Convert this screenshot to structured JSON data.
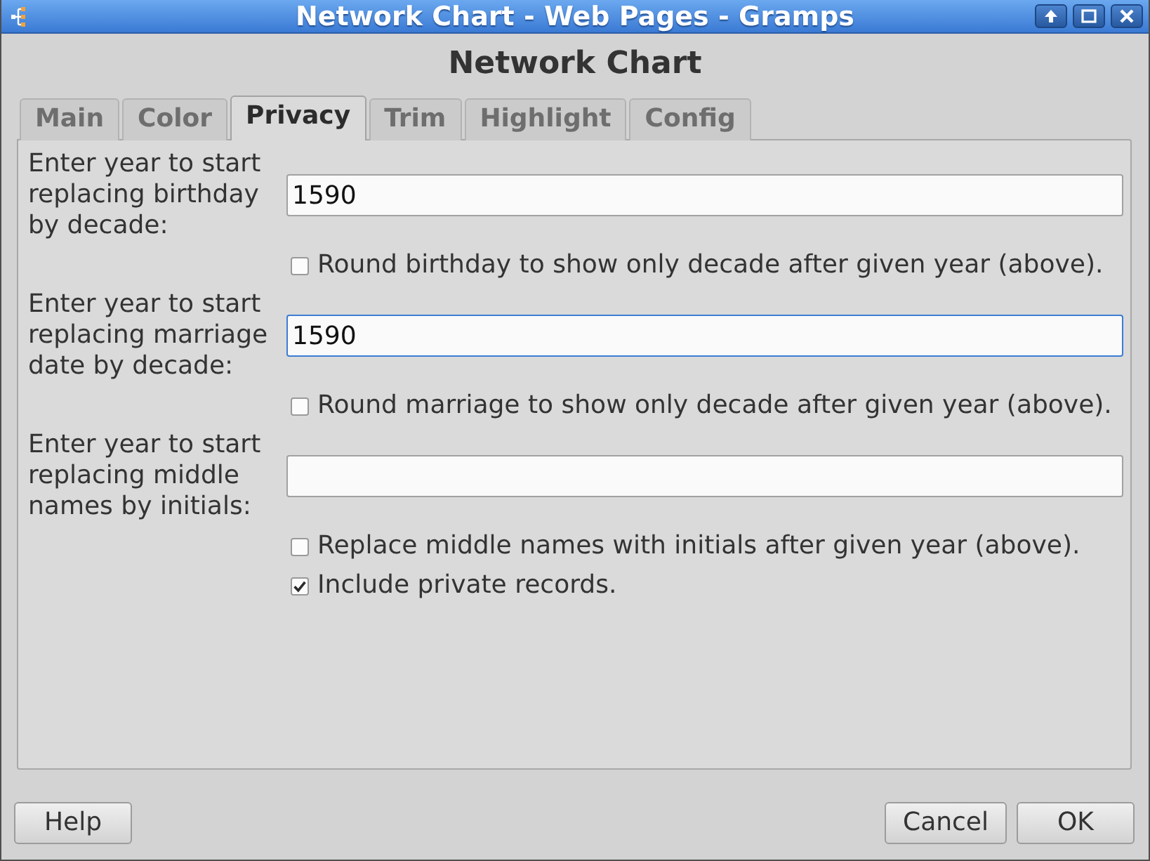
{
  "window": {
    "title": "Network Chart - Web Pages - Gramps"
  },
  "heading": "Network Chart",
  "tabs": [
    {
      "label": "Main",
      "selected": false
    },
    {
      "label": "Color",
      "selected": false
    },
    {
      "label": "Privacy",
      "selected": true
    },
    {
      "label": "Trim",
      "selected": false
    },
    {
      "label": "Highlight",
      "selected": false
    },
    {
      "label": "Config",
      "selected": false
    }
  ],
  "options": [
    {
      "kind": "entry",
      "label": "Enter year to start replacing birthday by decade:",
      "value": "1590",
      "focused": false
    },
    {
      "kind": "checkbox",
      "label": "Round birthday to show only decade after given year (above).",
      "checked": false
    },
    {
      "kind": "entry",
      "label": "Enter year to start replacing marriage date by decade:",
      "value": "1590",
      "focused": true
    },
    {
      "kind": "checkbox",
      "label": "Round marriage to show only decade after given year (above).",
      "checked": false
    },
    {
      "kind": "entry",
      "label": "Enter year to start replacing middle names by initials:",
      "focused": false
    },
    {
      "kind": "checkbox",
      "label": "Replace middle names with initials after given year (above).",
      "checked": false
    },
    {
      "kind": "checkbox",
      "label": "Include private records.",
      "checked": true
    }
  ],
  "help_button": "Help",
  "buttons": [
    "Cancel",
    "OK"
  ]
}
